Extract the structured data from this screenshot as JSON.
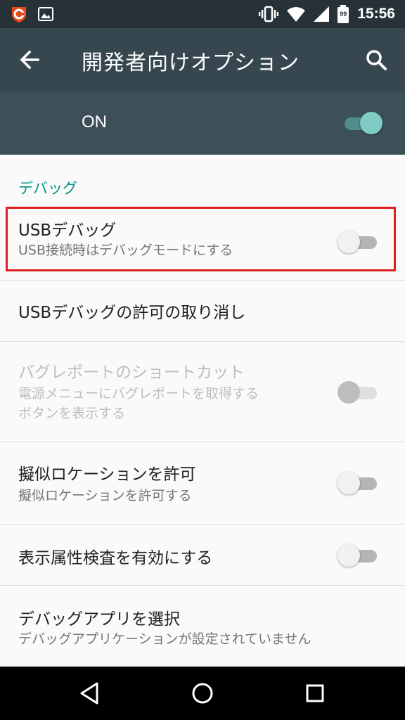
{
  "status_bar": {
    "time": "15:56",
    "battery_level": "99",
    "icons": [
      "app-shield-icon",
      "image-icon",
      "vibrate-icon",
      "wifi-icon",
      "cellular-signal-icon",
      "battery-icon"
    ]
  },
  "app_bar": {
    "title": "開発者向けオプション",
    "icons": [
      "back-arrow-icon",
      "search-icon"
    ]
  },
  "master_switch": {
    "label": "ON",
    "state": "on"
  },
  "section": {
    "header": "デバッグ"
  },
  "settings": [
    {
      "title": "USBデバッグ",
      "summary": "USB接続時はデバッグモードにする",
      "toggle": "off",
      "enabled": true,
      "highlighted": true
    },
    {
      "title": "USBデバッグの許可の取り消し",
      "enabled": true
    },
    {
      "title": "バグレポートのショートカット",
      "summary_line1": "電源メニューにバグレポートを取得する",
      "summary_line2": "ボタンを表示する",
      "toggle": "off",
      "enabled": false
    },
    {
      "title": "擬似ロケーションを許可",
      "summary": "擬似ロケーションを許可する",
      "toggle": "off",
      "enabled": true
    },
    {
      "title": "表示属性検査を有効にする",
      "toggle": "off",
      "enabled": true
    },
    {
      "title": "デバッグアプリを選択",
      "summary": "デバッグアプリケーションが設定されていません",
      "enabled": true
    }
  ],
  "nav_bar": {
    "icons": [
      "nav-back-icon",
      "nav-home-icon",
      "nav-recents-icon"
    ]
  },
  "colors": {
    "status_bar": "#263238",
    "app_bar": "#37474f",
    "accent": "#009688",
    "highlight_box": "#e02020"
  }
}
